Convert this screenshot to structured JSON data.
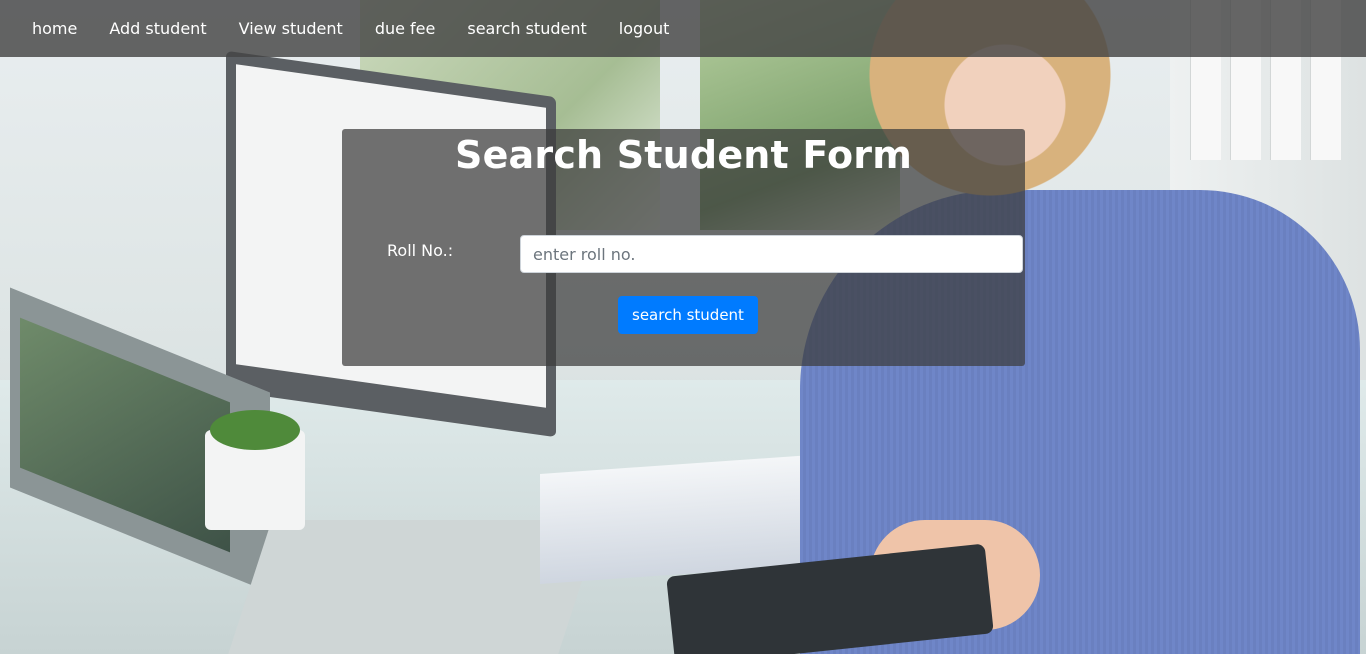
{
  "nav": {
    "links": [
      {
        "label": "home"
      },
      {
        "label": "Add student"
      },
      {
        "label": "View student"
      },
      {
        "label": "due fee"
      },
      {
        "label": "search student"
      },
      {
        "label": "logout"
      }
    ]
  },
  "form": {
    "title": "Search Student Form",
    "roll_label": "Roll No.:",
    "roll_placeholder": "enter roll no.",
    "roll_value": "",
    "submit_label": "search student"
  },
  "colors": {
    "navbar_bg": "#444444",
    "panel_bg": "#3c3c3c",
    "primary": "#007bff",
    "text": "#ffffff"
  }
}
